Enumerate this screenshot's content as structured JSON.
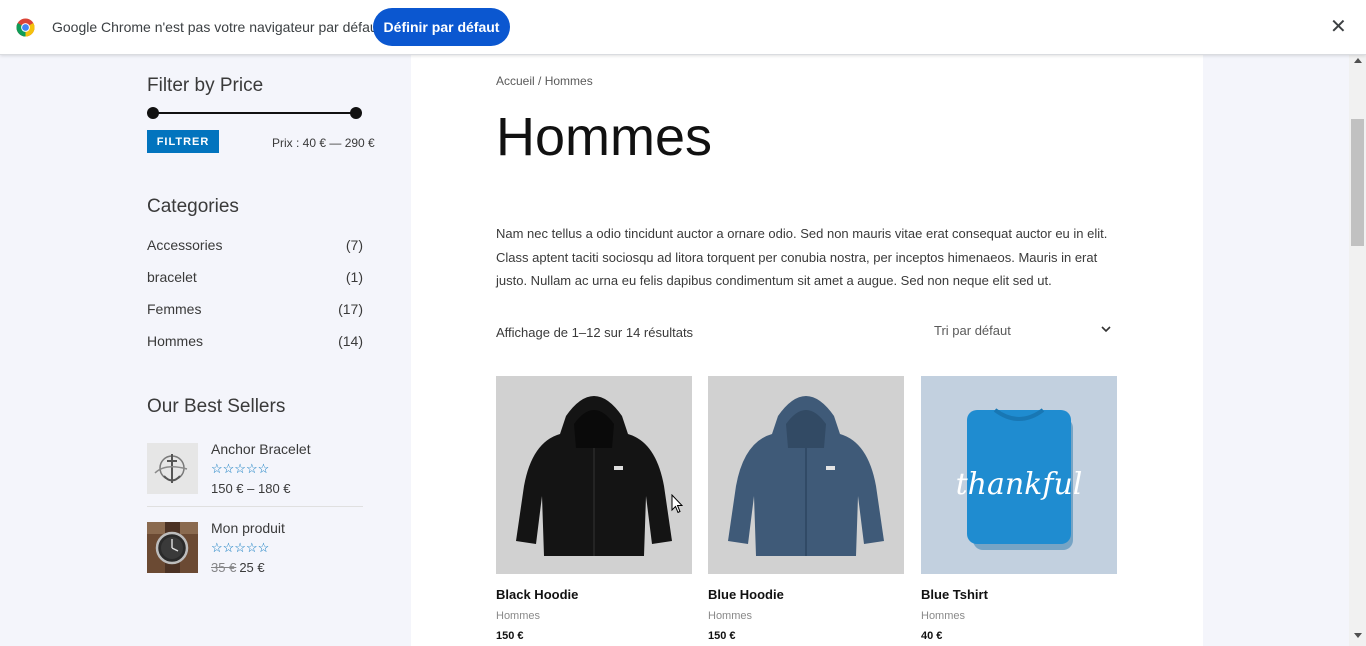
{
  "infobar": {
    "message": "Google Chrome n'est pas votre navigateur par défaut",
    "button_label": "Définir par défaut",
    "close_glyph": "✕"
  },
  "sidebar": {
    "price_filter": {
      "title": "Filter by Price",
      "button_label": "FILTRER",
      "price_text": "Prix : 40 € — 290 €",
      "range_min_fraction": 0,
      "range_max_fraction": 1
    },
    "categories": {
      "title": "Categories",
      "items": [
        {
          "name": "Accessories",
          "count": "(7)"
        },
        {
          "name": "bracelet",
          "count": "(1)"
        },
        {
          "name": "Femmes",
          "count": "(17)"
        },
        {
          "name": "Hommes",
          "count": "(14)"
        }
      ]
    },
    "best_sellers": {
      "title": "Our Best Sellers",
      "items": [
        {
          "name": "Anchor Bracelet",
          "stars": "☆☆☆☆☆",
          "rating": 0,
          "price": "150 € – 180 €",
          "old_price": ""
        },
        {
          "name": "Mon produit",
          "stars": "☆☆☆☆☆",
          "rating": 0,
          "price": "25 €",
          "old_price": "35 €"
        }
      ]
    }
  },
  "main": {
    "breadcrumb": {
      "home": "Accueil",
      "separator": " / ",
      "current": "Hommes"
    },
    "title": "Hommes",
    "description": "Nam nec tellus a odio tincidunt auctor a ornare odio. Sed non mauris vitae erat consequat auctor eu in elit. Class aptent taciti sociosqu ad litora torquent per conubia nostra, per inceptos himenaeos. Mauris in erat justo. Nullam ac urna eu felis dapibus condimentum sit amet a augue. Sed non neque elit sed ut.",
    "result_count": "Affichage de 1–12 sur 14 résultats",
    "sort_selected": "Tri par défaut",
    "products": [
      {
        "name": "Black Hoodie",
        "category": "Hommes",
        "price": "150 €",
        "image": "black-hoodie"
      },
      {
        "name": "Blue Hoodie",
        "category": "Hommes",
        "price": "150 €",
        "image": "blue-hoodie"
      },
      {
        "name": "Blue Tshirt",
        "category": "Hommes",
        "price": "40 €",
        "image": "blue-tshirt",
        "image_text": "thankful"
      }
    ]
  },
  "colors": {
    "accent": "#0274be",
    "chrome_button": "#0b57d0",
    "sidebar_bg": "#f4f5fb"
  },
  "icons": [
    "chrome-logo-icon",
    "close-icon",
    "chevron-down-icon",
    "star-outline-icon"
  ]
}
